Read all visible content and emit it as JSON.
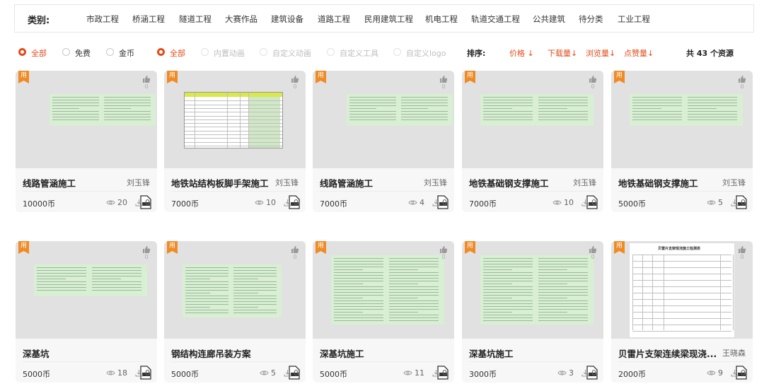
{
  "categories": {
    "label": "类别:",
    "items": [
      "市政工程",
      "桥涵工程",
      "隧道工程",
      "大赛作品",
      "建筑设备",
      "道路工程",
      "民用建筑工程",
      "机电工程",
      "轨道交通工程",
      "公共建筑",
      "待分类",
      "工业工程"
    ]
  },
  "filters": {
    "price": [
      {
        "label": "全部",
        "selected": true
      },
      {
        "label": "免费",
        "selected": false
      },
      {
        "label": "金币",
        "selected": false
      }
    ],
    "type": [
      {
        "label": "全部",
        "selected": true
      },
      {
        "label": "内置动画",
        "selected": false
      },
      {
        "label": "自定义动画",
        "selected": false
      },
      {
        "label": "自定义工具",
        "selected": false
      },
      {
        "label": "自定义logo",
        "selected": false
      }
    ]
  },
  "sort": {
    "label": "排序:",
    "items": [
      "价格 ↓",
      "下载量↓",
      "浏览量↓",
      "点赞量↓"
    ]
  },
  "total": "共 43 个资源",
  "colors": {
    "accent": "#e64a19",
    "badge": "#f08a24",
    "thumb_doc": "#d8efd3"
  },
  "cards": [
    {
      "badge": "用",
      "likes": "0",
      "title": "线路管涵施工",
      "author": "刘玉锋",
      "price": "10000币",
      "views": "20",
      "downloads": "0"
    },
    {
      "badge": "用",
      "likes": "0",
      "title": "地铁站结构板脚手架施工",
      "author": "刘玉锋",
      "price": "7000币",
      "views": "10",
      "downloads": "0"
    },
    {
      "badge": "用",
      "likes": "0",
      "title": "线路管涵施工",
      "author": "刘玉锋",
      "price": "7000币",
      "views": "4",
      "downloads": "0"
    },
    {
      "badge": "用",
      "likes": "0",
      "title": "地铁基础钢支撑施工",
      "author": "刘玉锋",
      "price": "7000币",
      "views": "10",
      "downloads": "0"
    },
    {
      "badge": "用",
      "likes": "0",
      "title": "地铁基础钢支撑施工",
      "author": "刘玉锋",
      "price": "5000币",
      "views": "5",
      "downloads": "0"
    },
    {
      "badge": "用",
      "likes": "0",
      "title": "深基坑",
      "author": "",
      "price": "5000币",
      "views": "18",
      "downloads": "0"
    },
    {
      "badge": "用",
      "likes": "0",
      "title": "钢结构连廊吊装方案",
      "author": "",
      "price": "5000币",
      "views": "5",
      "downloads": "0"
    },
    {
      "badge": "用",
      "likes": "0",
      "title": "深基坑施工",
      "author": "",
      "price": "5000币",
      "views": "11",
      "downloads": "0"
    },
    {
      "badge": "用",
      "likes": "0",
      "title": "深基坑施工",
      "author": "",
      "price": "3000币",
      "views": "3",
      "downloads": "0"
    },
    {
      "badge": "用",
      "likes": "0",
      "title": "贝雷片支架连续梁现浇...",
      "author": "王晓森",
      "price": "2000币",
      "views": "9",
      "downloads": "0",
      "thumb_title": "贝雷片支架现浇施工检测表"
    }
  ]
}
